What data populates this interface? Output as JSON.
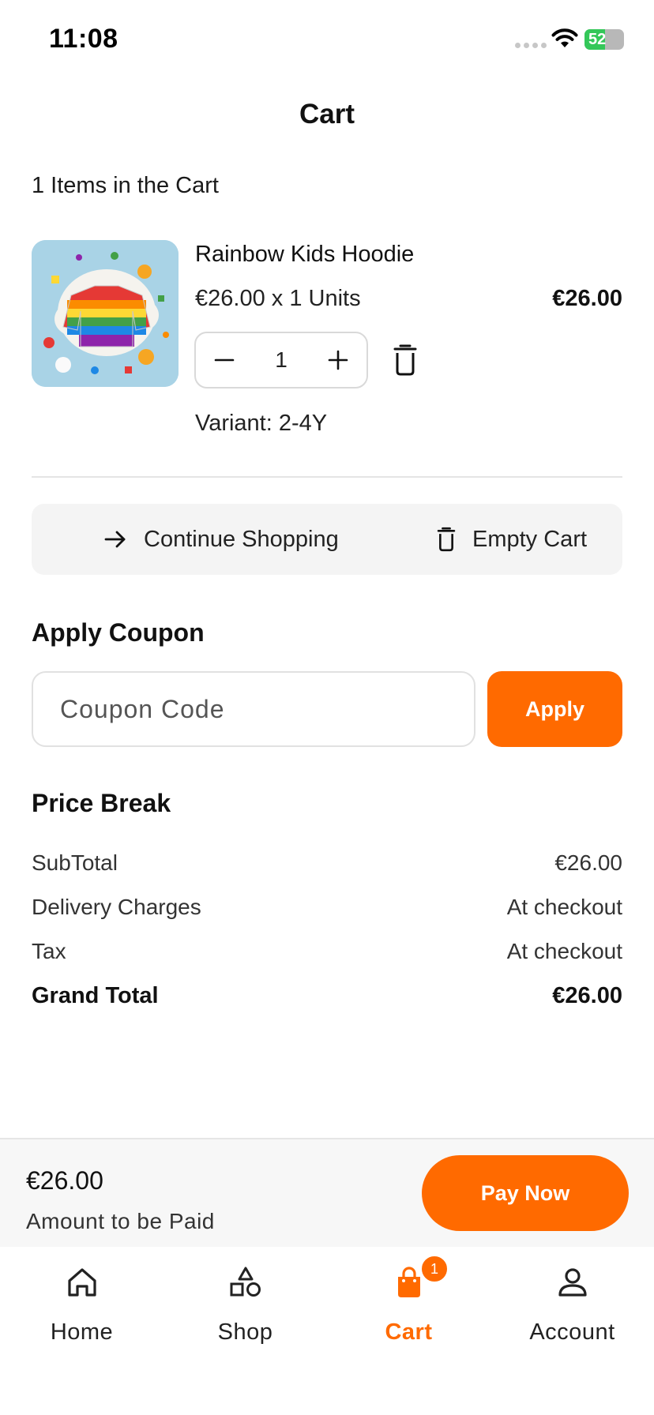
{
  "status_bar": {
    "time": "11:08",
    "battery_percent": "52",
    "battery_level": 0.52
  },
  "header": {
    "title": "Cart"
  },
  "cart": {
    "items_count_text": "1 Items in the Cart",
    "items": [
      {
        "name": "Rainbow Kids Hoodie",
        "unit_price_text": "€26.00 x 1 Units",
        "total": "€26.00",
        "quantity": "1",
        "variant_text": "Variant: 2-4Y",
        "image_icon": "rainbow-sweater-image"
      }
    ]
  },
  "actions": {
    "continue_label": "Continue Shopping",
    "empty_label": "Empty Cart"
  },
  "coupon": {
    "title": "Apply Coupon",
    "placeholder": "Coupon Code",
    "value": "",
    "apply_label": "Apply"
  },
  "price_break": {
    "title": "Price Break",
    "rows": [
      {
        "label": "SubTotal",
        "value": "€26.00"
      },
      {
        "label": "Delivery Charges",
        "value": "At checkout"
      },
      {
        "label": "Tax",
        "value": "At checkout"
      }
    ],
    "grand_total": {
      "label": "Grand Total",
      "value": "€26.00"
    }
  },
  "pay_bar": {
    "amount": "€26.00",
    "caption": "Amount to be Paid",
    "button_label": "Pay Now"
  },
  "bottom_nav": {
    "items": [
      {
        "label": "Home",
        "icon": "home-icon",
        "active": false
      },
      {
        "label": "Shop",
        "icon": "shapes-icon",
        "active": false
      },
      {
        "label": "Cart",
        "icon": "bag-icon",
        "active": true,
        "badge": "1"
      },
      {
        "label": "Account",
        "icon": "user-icon",
        "active": false
      }
    ]
  },
  "colors": {
    "accent": "#ff6a00",
    "battery_green": "#34c759",
    "panel": "#f4f4f4"
  }
}
